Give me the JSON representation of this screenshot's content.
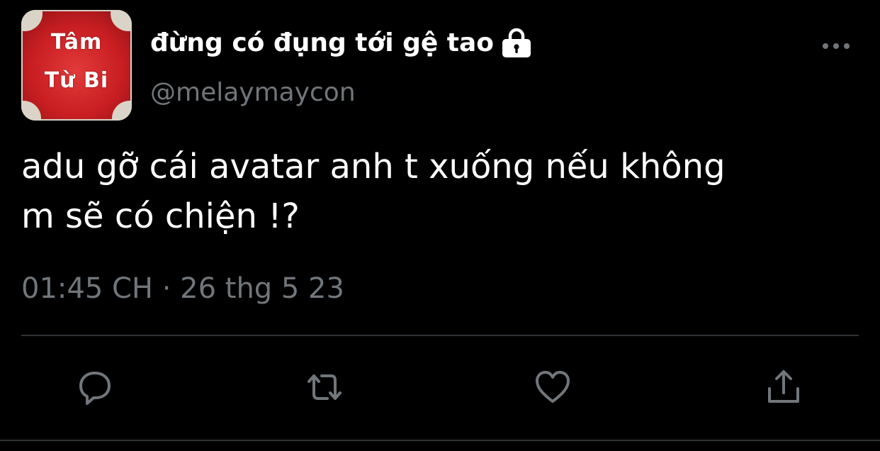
{
  "tweet": {
    "avatar": {
      "line1": "Tâm",
      "line2": "Từ Bi"
    },
    "display_name": "đừng có đụng tới gệ tao",
    "handle": "@melaymaycon",
    "text": "adu gỡ cái avatar anh t xuống nếu không\nm sẽ có chiện !?",
    "timestamp": "01:45 CH · 26 thg 5 23"
  },
  "icons": {
    "lock": "lock-icon",
    "more": "more-horizontal-icon",
    "reply": "reply-icon",
    "retweet": "retweet-icon",
    "like": "heart-icon",
    "share": "share-icon"
  },
  "colors": {
    "background": "#000000",
    "primary_text": "#ffffff",
    "secondary_text": "#71767b",
    "divider": "#2f3336",
    "avatar_red": "#c81e22"
  }
}
